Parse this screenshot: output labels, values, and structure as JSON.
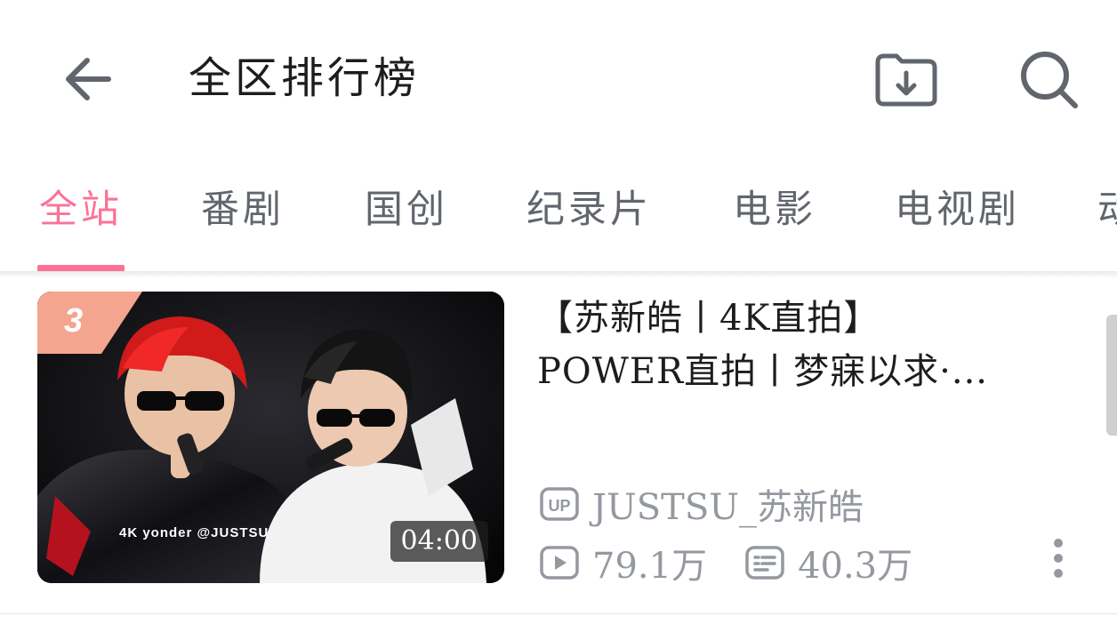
{
  "header": {
    "title": "全区排行榜",
    "back_icon": "arrow-left-icon",
    "download_icon": "download-folder-icon",
    "search_icon": "search-icon"
  },
  "tabs": [
    {
      "label": "全站",
      "active": true
    },
    {
      "label": "番剧",
      "active": false
    },
    {
      "label": "国创",
      "active": false
    },
    {
      "label": "纪录片",
      "active": false
    },
    {
      "label": "电影",
      "active": false
    },
    {
      "label": "电视剧",
      "active": false
    },
    {
      "label": "动",
      "active": false
    }
  ],
  "video": {
    "rank": "3",
    "duration": "04:00",
    "title_line1": "【苏新皓丨4K直拍】",
    "title_line2": "POWER直拍丨梦寐以求·...",
    "thumbnail_overlay": "4K  yonder  @JUSTSU",
    "up_badge": "UP",
    "uploader": "JUSTSU_苏新皓",
    "views": "79.1万",
    "danmaku": "40.3万"
  },
  "colors": {
    "accent": "#fb7299",
    "text_primary": "#1d1d1f",
    "text_secondary": "#61666d",
    "text_muted": "#9499a0"
  }
}
